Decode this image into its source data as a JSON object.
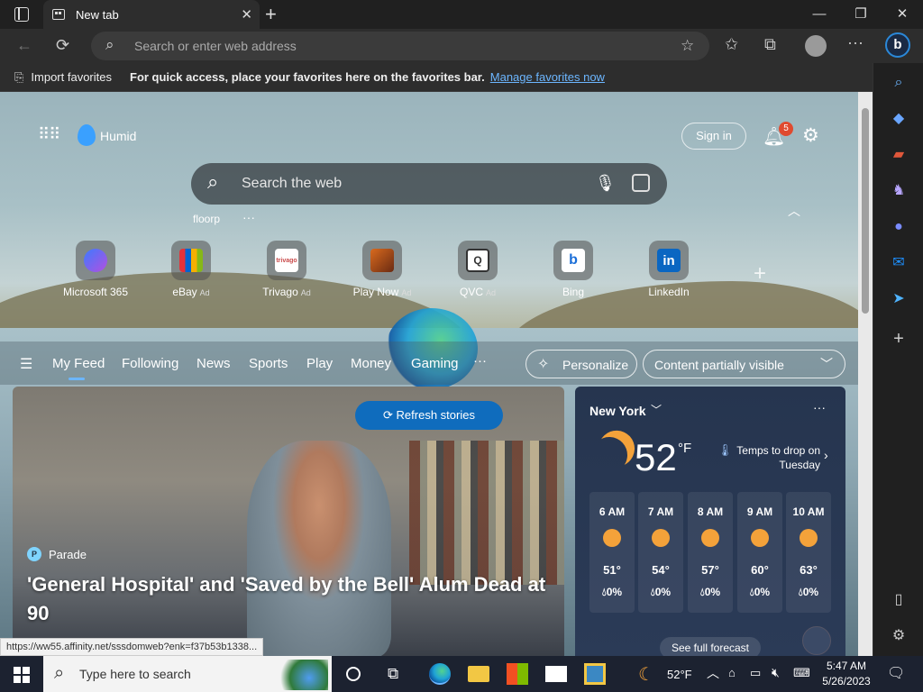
{
  "browser": {
    "tab_title": "New tab",
    "address_placeholder": "Search or enter web address",
    "favbar": {
      "import_label": "Import favorites",
      "hint": "For quick access, place your favorites here on the favorites bar.",
      "manage_link": "Manage favorites now"
    },
    "status_url": "https://ww55.affinity.net/sssdomweb?enk=f37b53b1338..."
  },
  "newtab": {
    "weather_brand": "Humid",
    "sign_in": "Sign in",
    "notification_count": "5",
    "search_placeholder": "Search the web",
    "floorp_label": "floorp",
    "more_dots": "···",
    "quick_links": [
      {
        "label": "Microsoft 365",
        "ad": ""
      },
      {
        "label": "eBay",
        "ad": "Ad"
      },
      {
        "label": "Trivago",
        "ad": "Ad"
      },
      {
        "label": "Play Now",
        "ad": "Ad"
      },
      {
        "label": "QVC",
        "ad": "Ad"
      },
      {
        "label": "Bing",
        "ad": ""
      },
      {
        "label": "LinkedIn",
        "ad": ""
      }
    ],
    "feed_tabs": [
      "My Feed",
      "Following",
      "News",
      "Sports",
      "Play",
      "Money",
      "Gaming"
    ],
    "feed_more": "···",
    "personalize": "Personalize",
    "content_visibility": "Content partially visible",
    "refresh": "Refresh stories",
    "hero": {
      "source": "Parade",
      "headline": "'General Hospital' and 'Saved by the Bell' Alum Dead at 90"
    },
    "weather": {
      "city": "New York",
      "temperature": "52",
      "unit": "°F",
      "alert": "Temps to drop on Tuesday",
      "hours": [
        {
          "time": "6 AM",
          "temp": "51°",
          "precip": "0%"
        },
        {
          "time": "7 AM",
          "temp": "54°",
          "precip": "0%"
        },
        {
          "time": "8 AM",
          "temp": "57°",
          "precip": "0%"
        },
        {
          "time": "9 AM",
          "temp": "60°",
          "precip": "0%"
        },
        {
          "time": "10 AM",
          "temp": "63°",
          "precip": "0%"
        }
      ],
      "forecast_link": "See full forecast"
    }
  },
  "taskbar": {
    "search_placeholder": "Type here to search",
    "weather_temp": "52°F",
    "time": "5:47 AM",
    "date": "5/26/2023"
  },
  "colors": {
    "accent": "#0f6cbd",
    "weather_bg": "#26354f",
    "link": "#6cb6ff"
  }
}
